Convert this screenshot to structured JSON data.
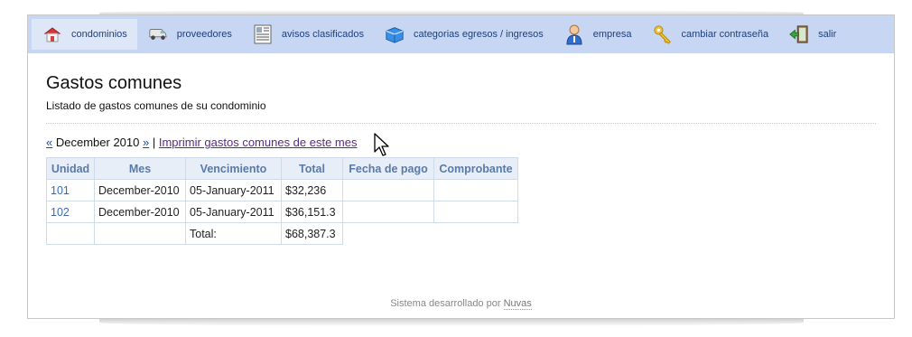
{
  "nav": {
    "items": [
      {
        "label": "condominios",
        "icon": "house-icon",
        "active": true
      },
      {
        "label": "proveedores",
        "icon": "van-icon",
        "active": false
      },
      {
        "label": "avisos clasificados",
        "icon": "newspaper-icon",
        "active": false
      },
      {
        "label": "categorias egresos / ingresos",
        "icon": "box-icon",
        "active": false
      },
      {
        "label": "empresa",
        "icon": "person-icon",
        "active": false
      },
      {
        "label": "cambiar contraseña",
        "icon": "key-icon",
        "active": false
      },
      {
        "label": "salir",
        "icon": "exit-door-icon",
        "active": false
      }
    ]
  },
  "page": {
    "title": "Gastos comunes",
    "subtitle": "Listado de gastos comunes de su condominio"
  },
  "month_nav": {
    "prev": "«",
    "current": "December 2010",
    "next": "»",
    "separator": "|",
    "print_link": "Imprimir gastos comunes de este mes"
  },
  "table": {
    "headers": [
      "Unidad",
      "Mes",
      "Vencimiento",
      "Total",
      "Fecha de pago",
      "Comprobante"
    ],
    "rows": [
      {
        "unidad": "101",
        "mes": "December-2010",
        "vencimiento": "05-January-2011",
        "total": "$32,236",
        "fecha_pago": "",
        "comprobante": ""
      },
      {
        "unidad": "102",
        "mes": "December-2010",
        "vencimiento": "05-January-2011",
        "total": "$36,151.3",
        "fecha_pago": "",
        "comprobante": ""
      }
    ],
    "total_label": "Total:",
    "total_value": "$68,387.3"
  },
  "footer": {
    "text": "Sistema desarrollado por",
    "link": "Nuvas"
  },
  "colors": {
    "nav_bg": "#c7d7f3",
    "link": "#1a4a9a",
    "table_header_bg": "#e7eef8"
  }
}
